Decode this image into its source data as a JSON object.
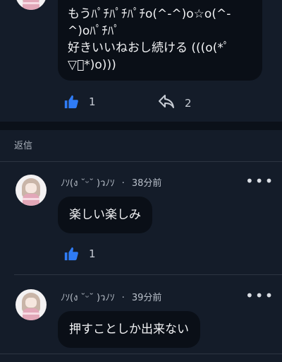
{
  "post": {
    "line1": "もうﾊﾟﾁﾊﾟﾁﾊﾟﾁo(^-^)o☆o(^-",
    "line2": "^)oﾊﾟﾁﾊﾟ",
    "line3": "好きいいねおし続ける (((o(*ﾟ",
    "line4": "▽ﾟ*)o)))",
    "like_count": "1",
    "share_count": "2"
  },
  "replies_section": {
    "title": "返信"
  },
  "replies": [
    {
      "username": "ﾉｿ(ง ˘ᵕ˘ )ว",
      "username_tail": "ﾉｿ",
      "time": "38分前",
      "text": "楽しい楽しみ",
      "like_count": "1"
    },
    {
      "username": "ﾉｿ(ง ˘ᵕ˘ )ว",
      "username_tail": "ﾉｿ",
      "time": "39分前",
      "text": "押すことしか出来ない"
    }
  ],
  "colors": {
    "background": "#141c29",
    "bubble": "#0a0f17",
    "like_blue": "#2f7cf6"
  },
  "icons": [
    "thumbs-up-icon",
    "share-icon",
    "more-dots-icon",
    "avatar-icon"
  ]
}
